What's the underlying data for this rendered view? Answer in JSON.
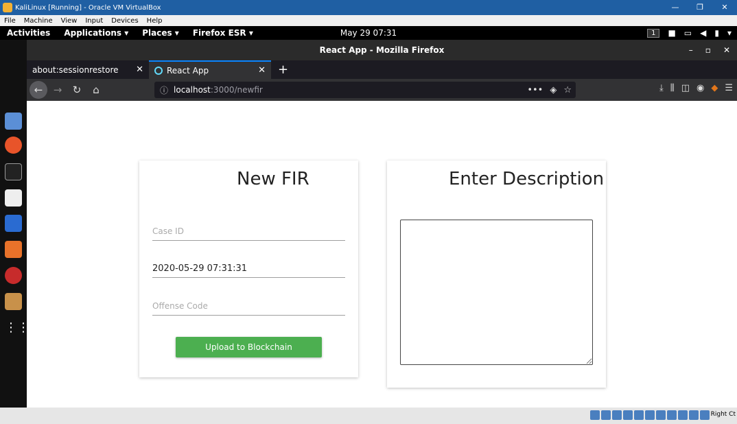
{
  "vbox": {
    "title": "KaliLinux [Running] - Oracle VM VirtualBox",
    "menu": [
      "File",
      "Machine",
      "View",
      "Input",
      "Devices",
      "Help"
    ],
    "window_buttons": [
      "—",
      "❐",
      "✕"
    ],
    "host_key": "Right Ct"
  },
  "gnome": {
    "activities": "Activities",
    "applications": "Applications ▾",
    "places": "Places ▾",
    "firefox": "Firefox ESR ▾",
    "clock": "May 29  07:31",
    "workspace": "1"
  },
  "firefox": {
    "window_title": "React App - Mozilla Firefox",
    "tabs": [
      {
        "label": "about:sessionrestore",
        "close": "✕"
      },
      {
        "label": "React App",
        "close": "✕"
      }
    ],
    "new_tab": "+",
    "url_host": "localhost",
    "url_path": ":3000/newfir",
    "info_icon": "ⓘ"
  },
  "page": {
    "fir_card": {
      "title": "New FIR",
      "case_id_placeholder": "Case ID",
      "datetime_value": "2020-05-29 07:31:31",
      "offense_code_placeholder": "Offense Code",
      "upload_button": "Upload to Blockchain"
    },
    "description_card": {
      "title": "Enter Description"
    }
  },
  "colors": {
    "accent_green": "#4caf50",
    "vbox_blue": "#1f5fa3",
    "tab_highlight": "#0a84ff"
  }
}
